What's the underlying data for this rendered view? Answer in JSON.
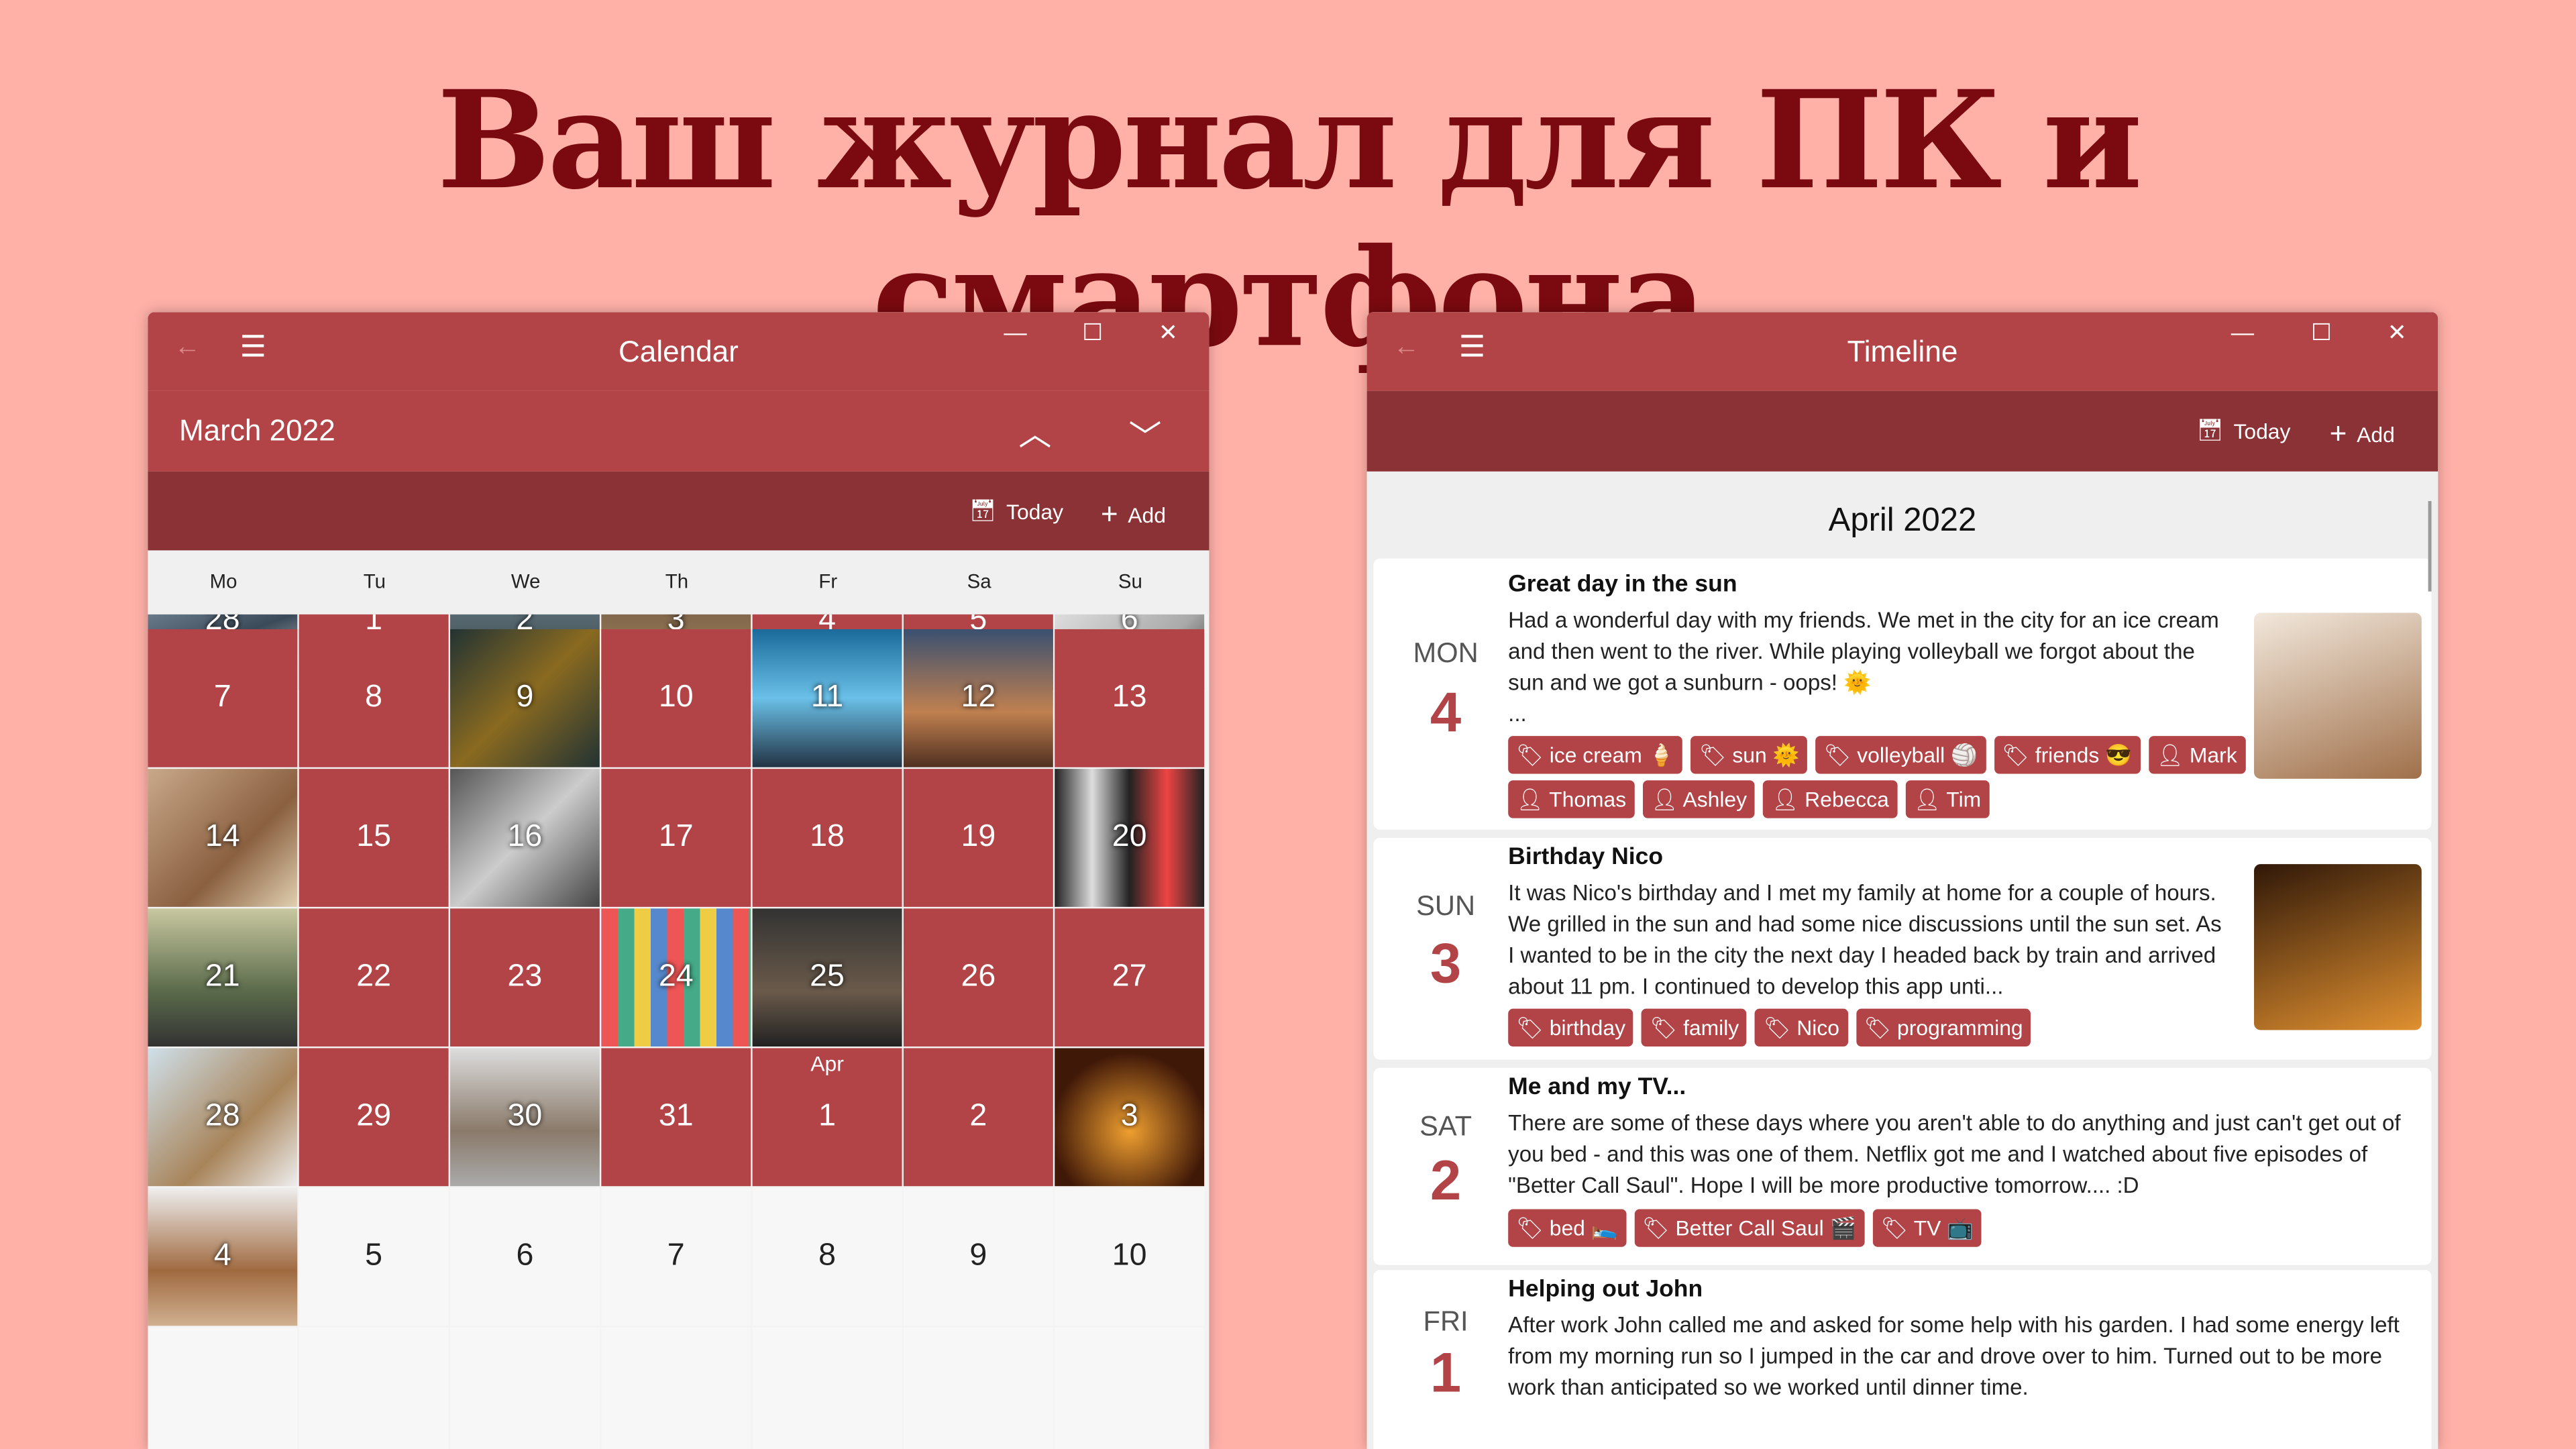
{
  "headline": "Ваш журнал для ПК и смартфона",
  "colors": {
    "background": "#ffb1a8",
    "accent": "#b24346",
    "toolbar": "#8b3236",
    "headline": "#7a0a0f"
  },
  "calendar": {
    "title": "Calendar",
    "month": "March 2022",
    "today": "Today",
    "add": "Add",
    "weekdays": [
      "Mo",
      "Tu",
      "We",
      "Th",
      "Fr",
      "Sa",
      "Su"
    ],
    "rows": [
      [
        {
          "d": "28",
          "p": 1
        },
        {
          "d": "1"
        },
        {
          "d": "2",
          "p": 1
        },
        {
          "d": "3",
          "p": 1
        },
        {
          "d": "4"
        },
        {
          "d": "5"
        },
        {
          "d": "6",
          "p": 1
        }
      ],
      [
        {
          "d": "7"
        },
        {
          "d": "8"
        },
        {
          "d": "9",
          "p": 1
        },
        {
          "d": "10"
        },
        {
          "d": "11",
          "p": 1
        },
        {
          "d": "12",
          "p": 1
        },
        {
          "d": "13"
        }
      ],
      [
        {
          "d": "14",
          "p": 1
        },
        {
          "d": "15"
        },
        {
          "d": "16",
          "p": 1
        },
        {
          "d": "17"
        },
        {
          "d": "18"
        },
        {
          "d": "19"
        },
        {
          "d": "20",
          "p": 1
        }
      ],
      [
        {
          "d": "21",
          "p": 1
        },
        {
          "d": "22"
        },
        {
          "d": "23"
        },
        {
          "d": "24",
          "p": 1
        },
        {
          "d": "25",
          "p": 1
        },
        {
          "d": "26"
        },
        {
          "d": "27"
        }
      ],
      [
        {
          "d": "28",
          "p": 1
        },
        {
          "d": "29"
        },
        {
          "d": "30",
          "p": 1
        },
        {
          "d": "31"
        },
        {
          "d": "1",
          "m": "Apr"
        },
        {
          "d": "2"
        },
        {
          "d": "3",
          "p": 1
        }
      ],
      [
        {
          "d": "4",
          "p": 1,
          "n": 1
        },
        {
          "d": "5",
          "n": 1
        },
        {
          "d": "6",
          "n": 1
        },
        {
          "d": "7",
          "n": 1
        },
        {
          "d": "8",
          "n": 1
        },
        {
          "d": "9",
          "n": 1
        },
        {
          "d": "10",
          "n": 1
        }
      ]
    ]
  },
  "timeline": {
    "title": "Timeline",
    "today": "Today",
    "add": "Add",
    "month": "April 2022",
    "entries": [
      {
        "day": "MON",
        "num": "4",
        "title": "Great day in the sun",
        "text": "Had a wonderful day with my friends. We met in the city for an ice cream and then went to the river. While playing volleyball we forgot about the sun and we got a sunburn - oops! 🌞",
        "more": "...",
        "tags": [
          {
            "t": "tag",
            "l": "ice cream 🍦"
          },
          {
            "t": "tag",
            "l": "sun 🌞"
          },
          {
            "t": "tag",
            "l": "volleyball 🏐"
          },
          {
            "t": "tag",
            "l": "friends 😎"
          },
          {
            "t": "person",
            "l": "Mark"
          },
          {
            "t": "person",
            "l": "Thomas"
          },
          {
            "t": "person",
            "l": "Ashley"
          },
          {
            "t": "person",
            "l": "Rebecca"
          },
          {
            "t": "person",
            "l": "Tim"
          }
        ]
      },
      {
        "day": "SUN",
        "num": "3",
        "title": "Birthday Nico",
        "text": "It was Nico's birthday and I met my family at home for a couple of hours. We grilled in the sun and had some nice discussions until the sun set. As I wanted to be in the city the next day I headed back by train and arrived about 11 pm. I continued to develop this app unti...",
        "tags": [
          {
            "t": "tag",
            "l": "birthday"
          },
          {
            "t": "tag",
            "l": "family"
          },
          {
            "t": "tag",
            "l": "Nico"
          },
          {
            "t": "tag",
            "l": "programming"
          }
        ]
      },
      {
        "day": "SAT",
        "num": "2",
        "title": "Me and my TV...",
        "text": "There are some of these days where you aren't able to do anything and just can't get out of you bed - and this was one of them. Netflix got me and I watched about five episodes of \"Better Call Saul\". Hope I will be more productive tomorrow.... :D",
        "tags": [
          {
            "t": "tag",
            "l": "bed 🛌"
          },
          {
            "t": "tag",
            "l": "Better Call Saul 🎬"
          },
          {
            "t": "tag",
            "l": "TV 📺"
          }
        ]
      },
      {
        "day": "FRI",
        "num": "1",
        "title": "Helping out John",
        "text": "After work John called me and asked for some help with his garden. I had some energy left from my morning run so I jumped in the car and drove over to him. Turned out to be more work than anticipated so we worked until dinner time.",
        "tags": []
      }
    ]
  }
}
